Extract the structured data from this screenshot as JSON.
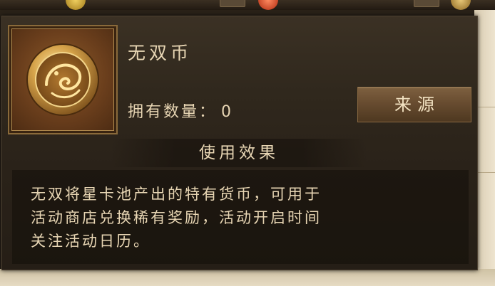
{
  "item": {
    "name": "无双币",
    "quantity_label": "拥有数量：",
    "quantity": "0",
    "icon": "dragon-coin-icon"
  },
  "actions": {
    "source_label": "来源"
  },
  "effect": {
    "header": "使用效果",
    "lines": [
      "无双将星卡池产出的特有货币，可用于",
      "活动商店兑换稀有奖励，活动开启时间",
      "关注活动日历。"
    ]
  },
  "colors": {
    "text": "#e8d6b4",
    "panel": "#2f271d",
    "button": "#6a4e32",
    "frame": "#8a6a3a"
  }
}
